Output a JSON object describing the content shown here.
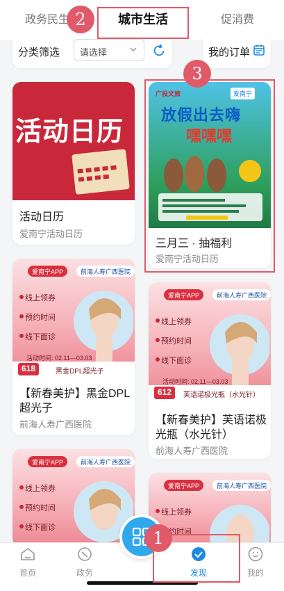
{
  "tabs": [
    {
      "label": "政务民生",
      "active": false
    },
    {
      "label": "城市生活",
      "active": true
    },
    {
      "label": "促消费",
      "active": false
    }
  ],
  "filter": {
    "label": "分类筛选",
    "placeholder": "请选择",
    "refresh_icon": "refresh-icon"
  },
  "order": {
    "label": "我的订单",
    "icon": "calendar-icon"
  },
  "cards": [
    {
      "title": "活动日历",
      "subtitle": "爱南宁活动日历",
      "banner_text": "活动日历"
    },
    {
      "title": "三月三 · 抽福利",
      "subtitle": "爱南宁活动日历",
      "banner_text_1": "放假出去嗨",
      "banner_text_2": "嘿嘿嘿",
      "brand_1": "广投文旅",
      "brand_2": "爱南宁"
    },
    {
      "title": "【新春美护】黑金DPL超光子",
      "subtitle": "前海人寿广西医院",
      "app": "爱南宁APP",
      "hospital": "前海人寿广西医院",
      "steps": [
        "线上领券",
        "预约时间",
        "线下面诊"
      ],
      "date": "活动时间: 02.11—03.03",
      "price": "618",
      "product": "黑金DPL超光子"
    },
    {
      "title": "【新春美护】芙语诺极光瓶（水光针）",
      "subtitle": "前海人寿广西医院",
      "app": "爱南宁APP",
      "hospital": "前海人寿广西医院",
      "steps": [
        "线上领券",
        "预约时间",
        "线下面诊"
      ],
      "date": "活动时间: 02.11—03.03",
      "price": "612",
      "product": "芙语诺极光瓶（水光针）"
    },
    {
      "app": "爱南宁APP",
      "hospital": "前海人寿广西医院",
      "steps": [
        "线上领券",
        "预约时间",
        "线下面诊"
      ]
    },
    {
      "app": "爱南宁APP",
      "hospital": "前海人寿广西医院",
      "steps": [
        "线上领券",
        "预约时间",
        "线下面诊"
      ]
    }
  ],
  "nav": [
    {
      "label": "首页",
      "icon": "home-icon"
    },
    {
      "label": "政务",
      "icon": "gov-icon"
    },
    {
      "label": "发现",
      "icon": "discover-icon",
      "active": true
    },
    {
      "label": "我的",
      "icon": "profile-icon"
    }
  ],
  "annotations": [
    "1",
    "2",
    "3"
  ],
  "colors": {
    "accent": "#1e88e5",
    "annotation": "#e05a6a",
    "calendar_red": "#c8283a"
  }
}
